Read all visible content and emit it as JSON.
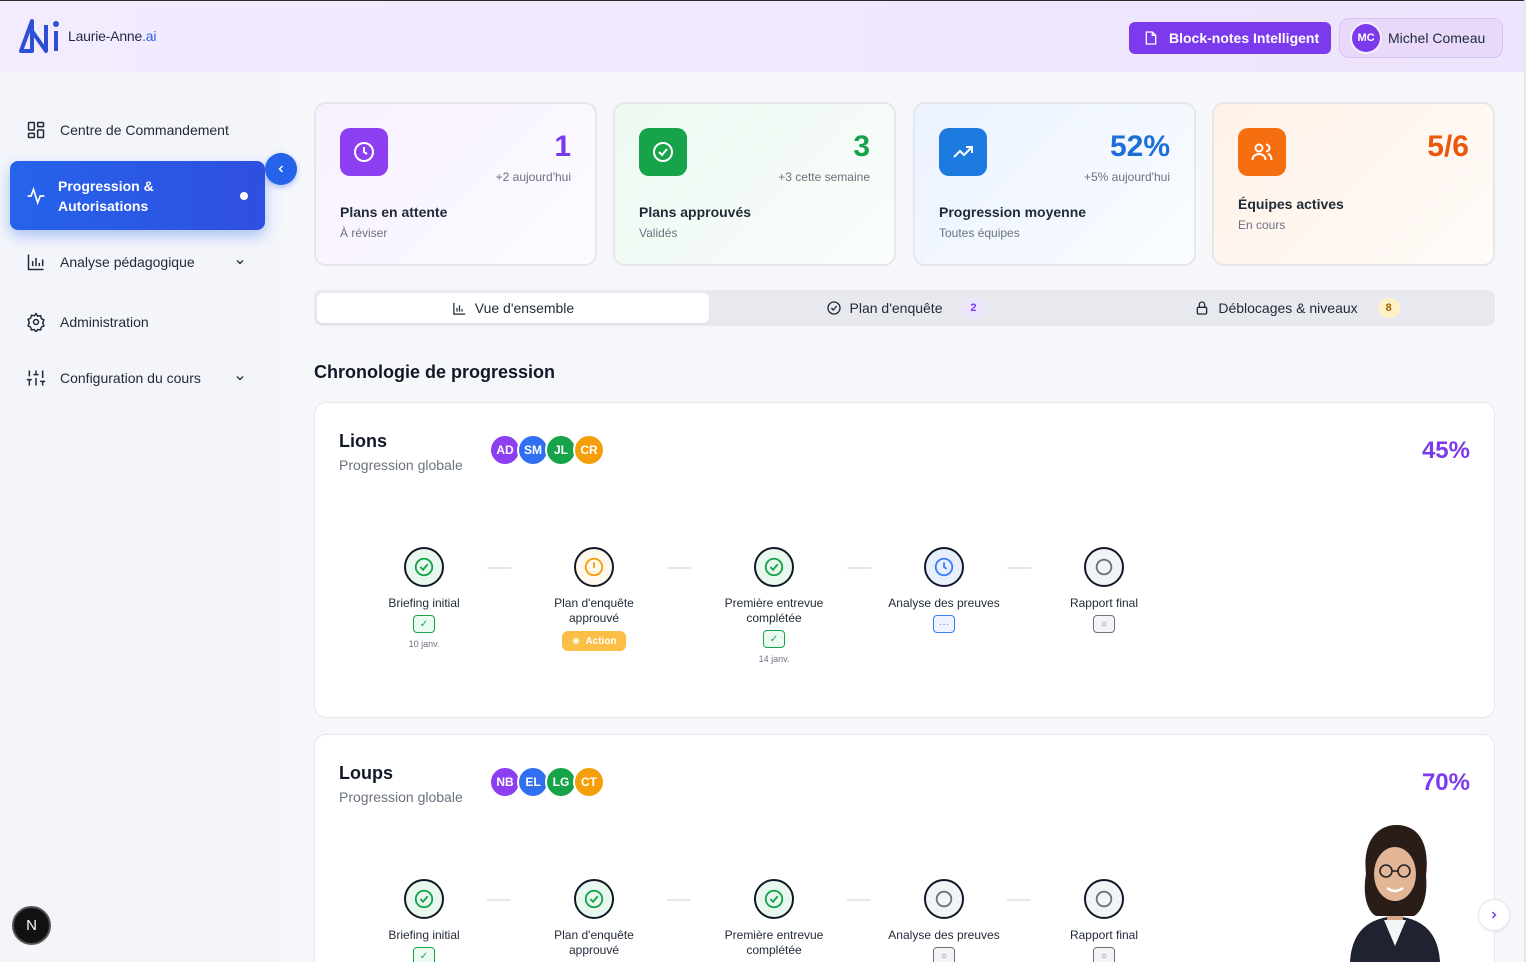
{
  "header": {
    "brand": "Laurie-Anne",
    "brand_suffix": ".ai",
    "notes_button": "Block-notes Intelligent",
    "user": {
      "initials": "MC",
      "name": "Michel Comeau"
    }
  },
  "sidebar": {
    "items": [
      {
        "label": "Centre de Commandement",
        "icon": "grid-icon"
      },
      {
        "label": "Progression & Autorisations",
        "icon": "activity-icon",
        "active": true
      },
      {
        "label": "Analyse pédagogique",
        "icon": "bar-chart-icon",
        "expandable": true
      },
      {
        "label": "Administration",
        "icon": "gear-icon"
      },
      {
        "label": "Configuration du cours",
        "icon": "sliders-icon",
        "expandable": true
      }
    ],
    "dev_badge": "N"
  },
  "stats": [
    {
      "value": "1",
      "delta": "+2 aujourd'hui",
      "label": "Plans en attente",
      "sub": "À réviser",
      "color": "#7c3aed",
      "icon": "clock-icon"
    },
    {
      "value": "3",
      "delta": "+3 cette semaine",
      "label": "Plans approuvés",
      "sub": "Validés",
      "color": "#16a34a",
      "icon": "check-circle-icon"
    },
    {
      "value": "52%",
      "delta": "+5% aujourd'hui",
      "label": "Progression moyenne",
      "sub": "Toutes équipes",
      "color": "#1d6fd6",
      "icon": "trending-up-icon"
    },
    {
      "value": "5/6",
      "delta": "",
      "label": "Équipes actives",
      "sub": "En cours",
      "color": "#ea580c",
      "icon": "users-icon"
    }
  ],
  "tabs": [
    {
      "label": "Vue d'ensemble",
      "icon": "bar-chart-icon",
      "active": true
    },
    {
      "label": "Plan d'enquête",
      "icon": "check-circle-icon",
      "badge": "2"
    },
    {
      "label": "Déblocages & niveaux",
      "icon": "lock-icon",
      "badge": "8"
    }
  ],
  "section_title": "Chronologie de progression",
  "teams": [
    {
      "name": "Lions",
      "subtitle": "Progression globale",
      "percent": "45%",
      "members": [
        "AD",
        "SM",
        "JL",
        "CR"
      ],
      "steps": [
        {
          "name": "Briefing initial",
          "status": "done",
          "date": "10 janv."
        },
        {
          "name": "Plan d'enquête approuvé",
          "status": "warning",
          "action": "Action"
        },
        {
          "name": "Première entrevue complétée",
          "status": "done",
          "date": "14 janv."
        },
        {
          "name": "Analyse des preuves",
          "status": "in-progress"
        },
        {
          "name": "Rapport final",
          "status": "pending"
        }
      ]
    },
    {
      "name": "Loups",
      "subtitle": "Progression globale",
      "percent": "70%",
      "members": [
        "NB",
        "EL",
        "LG",
        "CT"
      ],
      "steps": [
        {
          "name": "Briefing initial",
          "status": "done"
        },
        {
          "name": "Plan d'enquête approuvé",
          "status": "done"
        },
        {
          "name": "Première entrevue complétée",
          "status": "done"
        },
        {
          "name": "Analyse des preuves",
          "status": "pending"
        },
        {
          "name": "Rapport final",
          "status": "pending"
        }
      ]
    }
  ],
  "colors": {
    "accent": "#7c3aed",
    "primary_blue": "#2563eb",
    "avatar_colors": [
      "#8b3ff0",
      "#2f6ff0",
      "#16a34a",
      "#f59e0b"
    ]
  }
}
